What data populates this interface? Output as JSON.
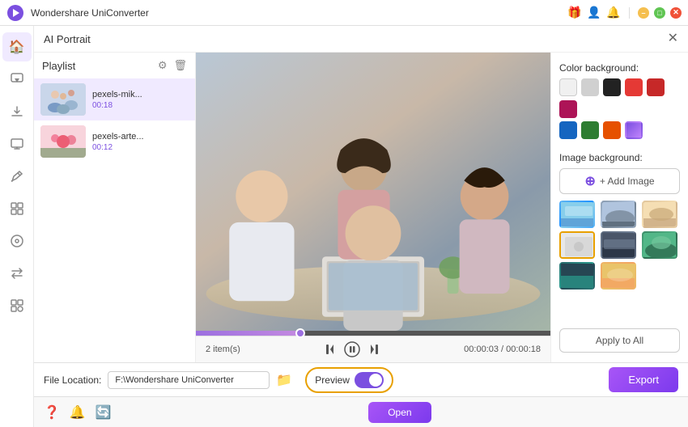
{
  "app": {
    "title": "Wondershare UniConverter",
    "logo_color": "#7b4fe0"
  },
  "titlebar": {
    "icons": {
      "gift": "🎁",
      "user": "👤",
      "bell": "🔔",
      "minimize": "–",
      "maximize": "□",
      "close": "✕"
    }
  },
  "panel": {
    "title": "AI Portrait",
    "close_label": "✕"
  },
  "playlist": {
    "title": "Playlist",
    "items": [
      {
        "name": "pexels-mik...",
        "duration": "00:18",
        "selected": true
      },
      {
        "name": "pexels-arte...",
        "duration": "00:12",
        "selected": false
      }
    ]
  },
  "video": {
    "items_count": "2 item(s)",
    "time_current": "00:00:03",
    "time_total": "00:00:18",
    "time_separator": " / ",
    "progress_percent": 30
  },
  "controls": {
    "prev": "⏮",
    "play_pause": "⏸",
    "next": "⏭"
  },
  "right_panel": {
    "color_bg_label": "Color background:",
    "swatches": [
      {
        "color": "#f0f0f0",
        "name": "white"
      },
      {
        "color": "#d0d0d0",
        "name": "light-gray"
      },
      {
        "color": "#222222",
        "name": "black"
      },
      {
        "color": "#e53935",
        "name": "red"
      },
      {
        "color": "#c62828",
        "name": "dark-red"
      },
      {
        "color": "#ad1457",
        "name": "pink"
      },
      {
        "color": "#1565c0",
        "name": "blue"
      },
      {
        "color": "#2e7d32",
        "name": "green"
      },
      {
        "color": "#e65100",
        "name": "orange"
      },
      {
        "color": "#7b4fe0",
        "name": "purple"
      }
    ],
    "image_bg_label": "Image background:",
    "add_image_label": "+ Add Image",
    "image_thumbs": [
      {
        "id": 1,
        "class": "img-t1",
        "selected": false
      },
      {
        "id": 2,
        "class": "img-t2",
        "selected": false
      },
      {
        "id": 3,
        "class": "img-t3",
        "selected": false
      },
      {
        "id": 4,
        "class": "img-t4",
        "selected": true
      },
      {
        "id": 5,
        "class": "img-t5",
        "selected": false
      },
      {
        "id": 6,
        "class": "img-t6",
        "selected": false
      },
      {
        "id": 7,
        "class": "img-t7",
        "selected": false
      },
      {
        "id": 8,
        "class": "img-t8",
        "selected": false
      }
    ],
    "apply_all_label": "Apply to All"
  },
  "bottom_bar": {
    "file_location_label": "File Location:",
    "file_path": "F:\\Wondershare UniConverter",
    "preview_label": "Preview",
    "preview_enabled": true,
    "export_label": "Export"
  },
  "very_bottom": {
    "open_label": "Open"
  },
  "sidebar": {
    "items": [
      {
        "icon": "🏠",
        "name": "home",
        "active": true
      },
      {
        "icon": "▶",
        "name": "convert"
      },
      {
        "icon": "⬇",
        "name": "download"
      },
      {
        "icon": "📺",
        "name": "screen"
      },
      {
        "icon": "✂",
        "name": "edit"
      },
      {
        "icon": "⊞",
        "name": "merge"
      },
      {
        "icon": "🎬",
        "name": "dvd"
      },
      {
        "icon": "📤",
        "name": "transfer"
      },
      {
        "icon": "⊞",
        "name": "toolbox"
      }
    ]
  }
}
